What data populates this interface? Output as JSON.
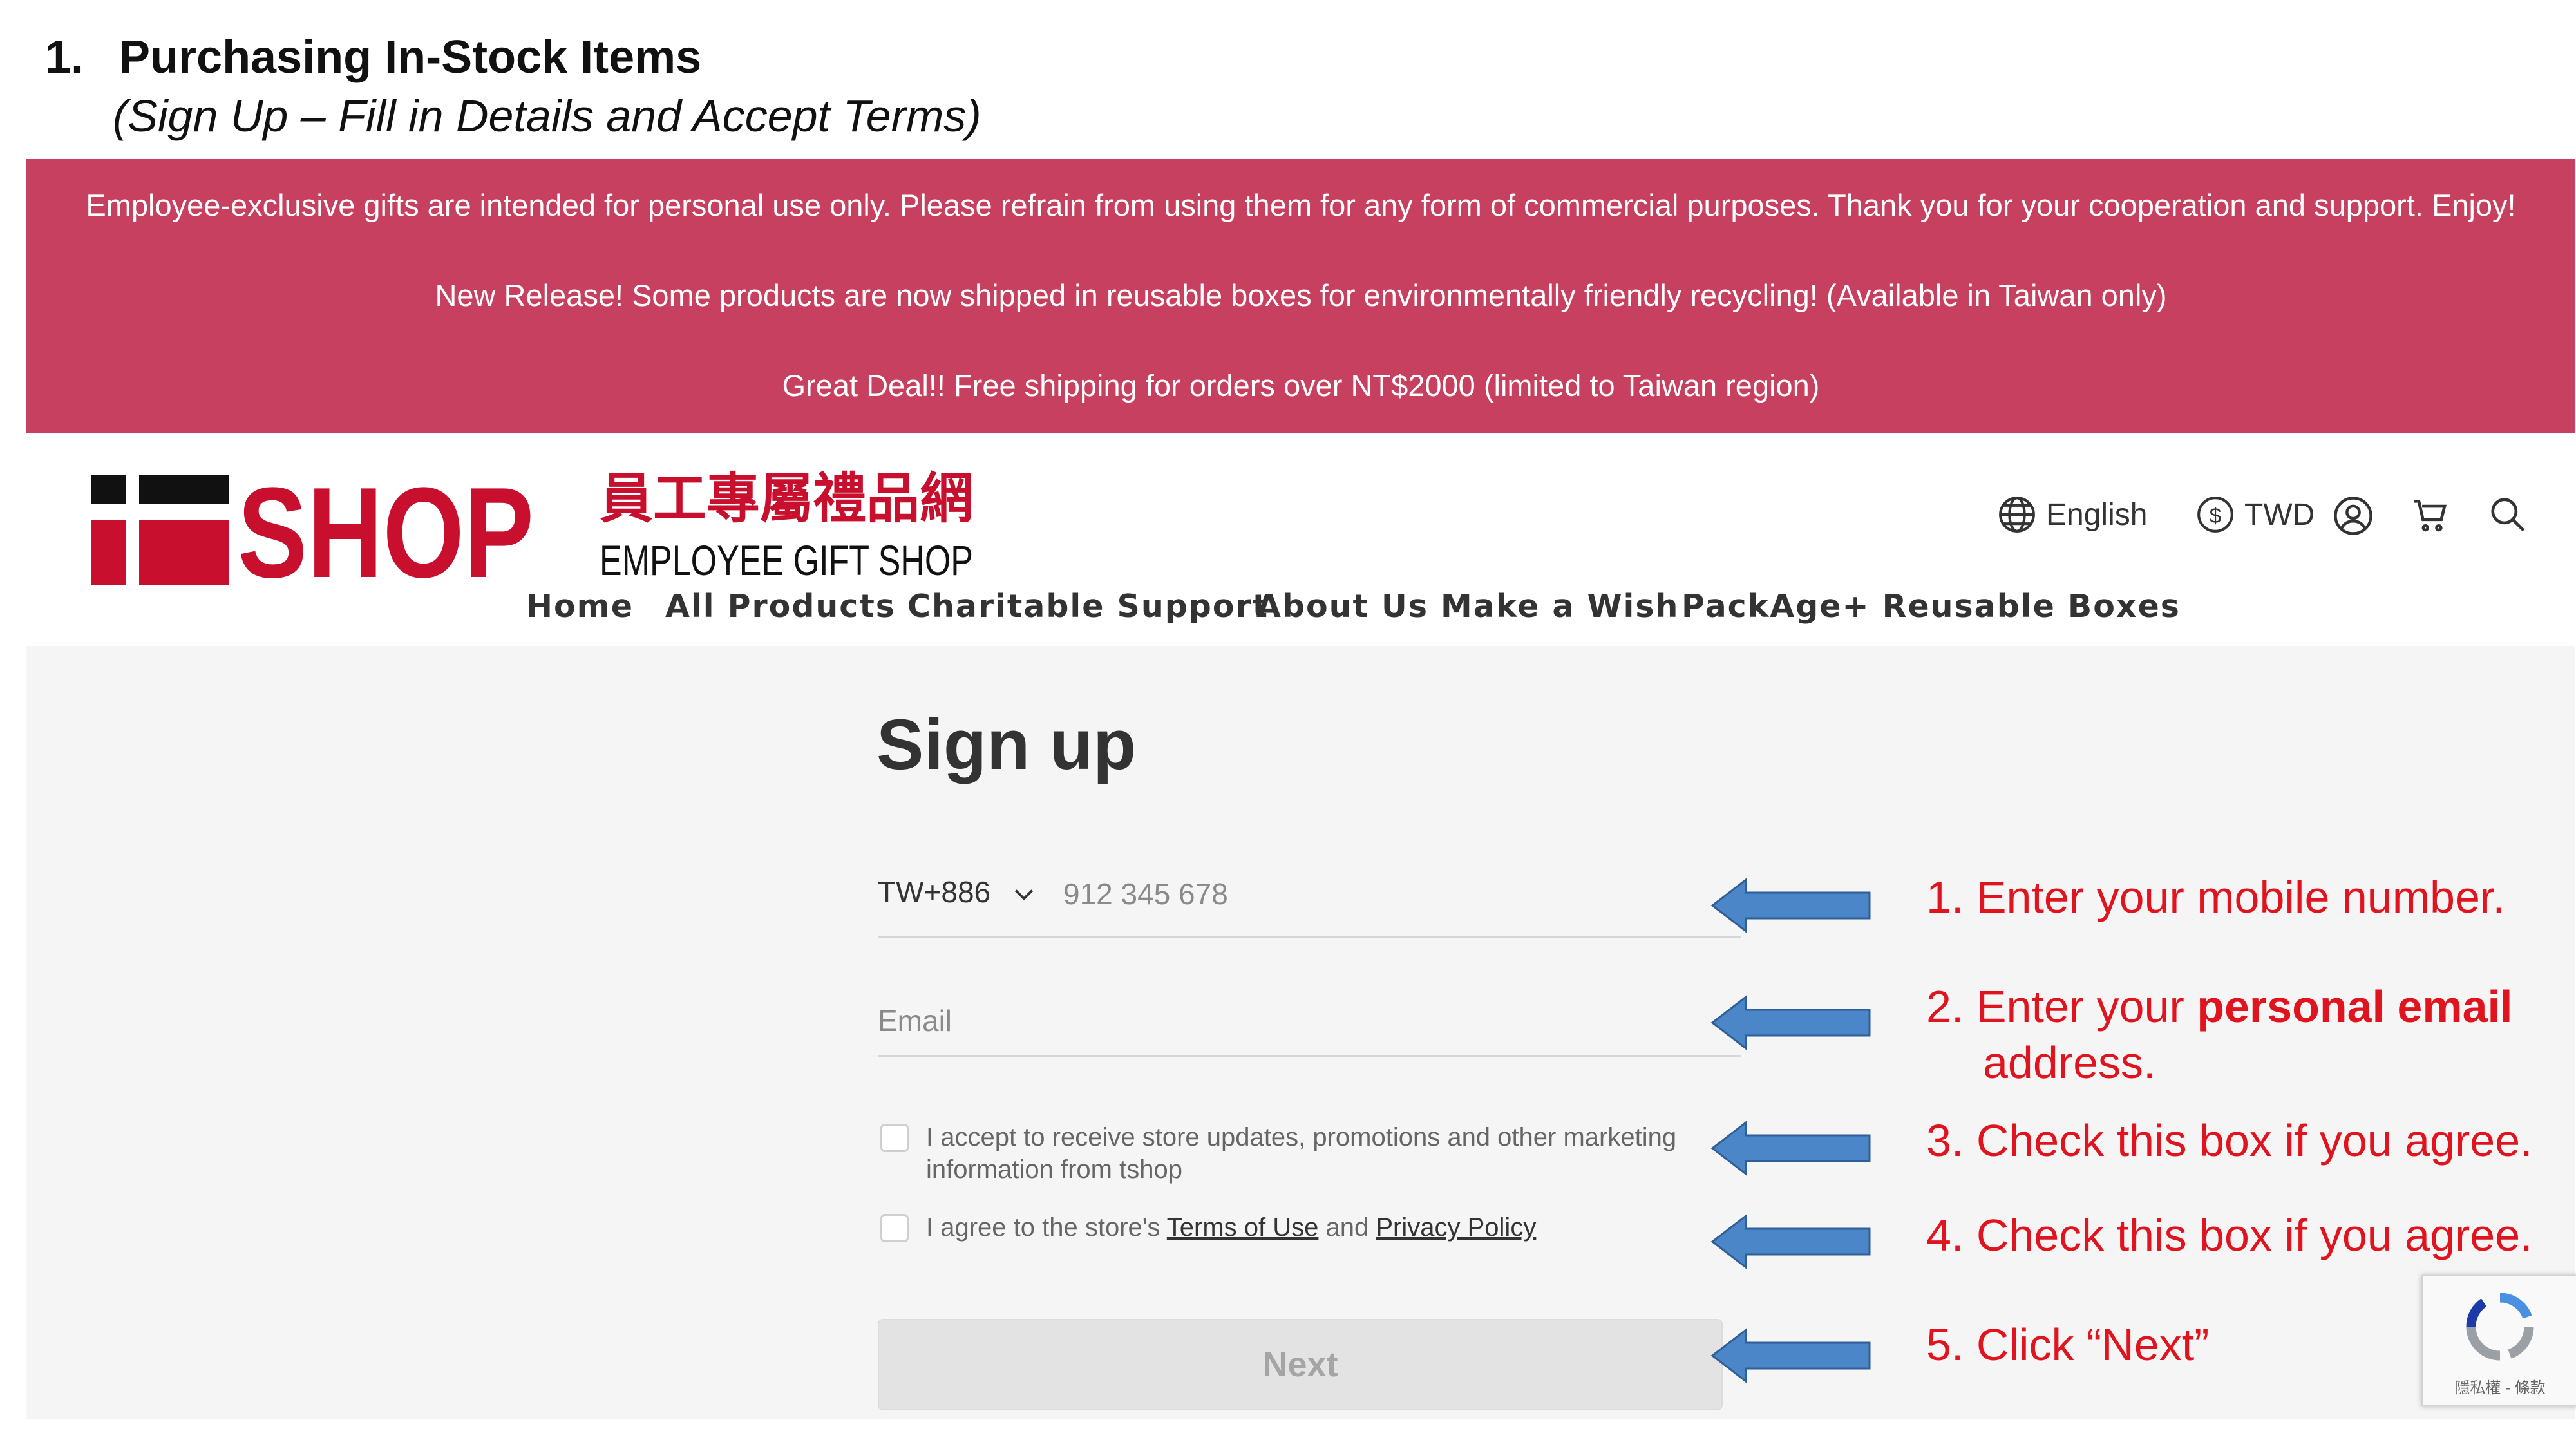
{
  "slide": {
    "number": "1.",
    "title": "Purchasing In-Stock Items",
    "subtitle": "(Sign Up – Fill in Details and Accept Terms)"
  },
  "banner": {
    "color": "#c8405f",
    "lines": [
      "Employee-exclusive gifts are intended for personal use only. Please refrain from using them for any form of commercial purposes. Thank you for your cooperation and support. Enjoy!",
      "New Release! Some products are now shipped in reusable boxes for environmentally friendly recycling! (Available in Taiwan only)",
      "Great Deal!! Free shipping for orders over NT$2000 (limited to Taiwan region)"
    ]
  },
  "header": {
    "logo": {
      "wordmark": "SHOP",
      "chinese": "員工專屬禮品網",
      "english": "EMPLOYEE GIFT SHOP",
      "brand_color": "#c8102e"
    },
    "language": "English",
    "currency": "TWD",
    "icons": [
      "globe-icon",
      "dollar-icon",
      "user-icon",
      "cart-icon",
      "search-icon"
    ],
    "nav": [
      "Home",
      "All Products",
      "Charitable Support",
      "About Us",
      "Make a Wish",
      "PackAge+ Reusable Boxes"
    ]
  },
  "form": {
    "title": "Sign up",
    "country_code": "TW+886",
    "phone_placeholder": "912 345 678",
    "email_placeholder": "Email",
    "marketing_consent_line1": "I accept to receive store updates, promotions and other marketing",
    "marketing_consent_line2": "information from tshop",
    "terms_prefix": "I agree to the store's ",
    "terms_link": "Terms of Use",
    "terms_middle": " and ",
    "privacy_link": "Privacy Policy",
    "next_label": "Next"
  },
  "annotations": {
    "color": "#e0141e",
    "arrow_color": "#4a86c8",
    "note1": "1. Enter your mobile number.",
    "note2_prefix": "2. Enter your ",
    "note2_bold": "personal email",
    "note2_line2": "address.",
    "note3": "3. Check this box if you agree.",
    "note4": "4. Check this box if you agree.",
    "note5": "5. Click “Next”"
  },
  "recaptcha": {
    "text": "隱私權 - 條款"
  }
}
